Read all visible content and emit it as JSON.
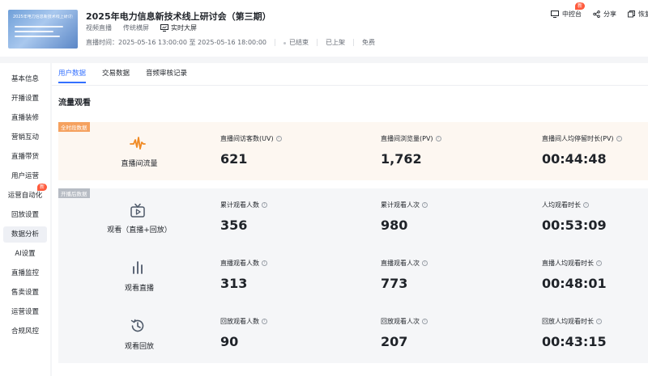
{
  "header": {
    "thumbnail_title": "2025年电力信息新技术线上研讨会（第三期）",
    "title": "2025年电力信息新技术线上研讨会（第三期）",
    "tags": [
      "视频直播",
      "传统横屏"
    ],
    "screen_label": "实时大屏",
    "time": "直播时间：2025-05-16 13:00:00 至 2025-05-16 18:00:00",
    "status": "已结束",
    "shelf": "已上架",
    "price": "免费",
    "actions": {
      "console": "中控台",
      "console_badge": "新",
      "share": "分享",
      "restore": "恢复"
    }
  },
  "sidebar": {
    "items": [
      {
        "label": "基本信息"
      },
      {
        "label": "开播设置"
      },
      {
        "label": "直播装修"
      },
      {
        "label": "营销互动"
      },
      {
        "label": "直播带货"
      },
      {
        "label": "用户运营"
      },
      {
        "label": "运营自动化",
        "badge": "新"
      },
      {
        "label": "回放设置"
      },
      {
        "label": "数据分析",
        "active": true
      },
      {
        "label": "AI设置"
      },
      {
        "label": "直播监控"
      },
      {
        "label": "售卖设置"
      },
      {
        "label": "运营设置"
      },
      {
        "label": "合规风控"
      }
    ]
  },
  "tabs": [
    {
      "label": "用户数据",
      "active": true
    },
    {
      "label": "交易数据"
    },
    {
      "label": "音频审核记录"
    }
  ],
  "section_title": "流量观看",
  "blocks": {
    "all_time_tag": "全时段数据",
    "after_start_tag": "开播后数据"
  },
  "rows": [
    {
      "name": "直播间流量",
      "icon": "waveform-icon",
      "metrics": [
        {
          "label": "直播间访客数(UV)",
          "value": "621"
        },
        {
          "label": "直播间浏览量(PV)",
          "value": "1,762"
        },
        {
          "label": "直播间人均停留时长(PV)",
          "value": "00:44:48"
        }
      ]
    },
    {
      "name": "观看（直播+回放）",
      "icon": "tv-play-icon",
      "metrics": [
        {
          "label": "累计观看人数",
          "value": "356"
        },
        {
          "label": "累计观看人次",
          "value": "980"
        },
        {
          "label": "人均观看时长",
          "value": "00:53:09"
        }
      ]
    },
    {
      "name": "观看直播",
      "icon": "bar-chart-icon",
      "metrics": [
        {
          "label": "直播观看人数",
          "value": "313"
        },
        {
          "label": "直播观看人次",
          "value": "773"
        },
        {
          "label": "直播人均观看时长",
          "value": "00:48:01"
        }
      ]
    },
    {
      "name": "观看回放",
      "icon": "history-icon",
      "metrics": [
        {
          "label": "回放观看人数",
          "value": "90"
        },
        {
          "label": "回放观看人次",
          "value": "207"
        },
        {
          "label": "回放人均观看时长",
          "value": "00:43:15"
        }
      ]
    }
  ],
  "colors": {
    "accent": "#3370ff",
    "orange_icon": "#f08a24",
    "badge": "#ff5a3c"
  }
}
